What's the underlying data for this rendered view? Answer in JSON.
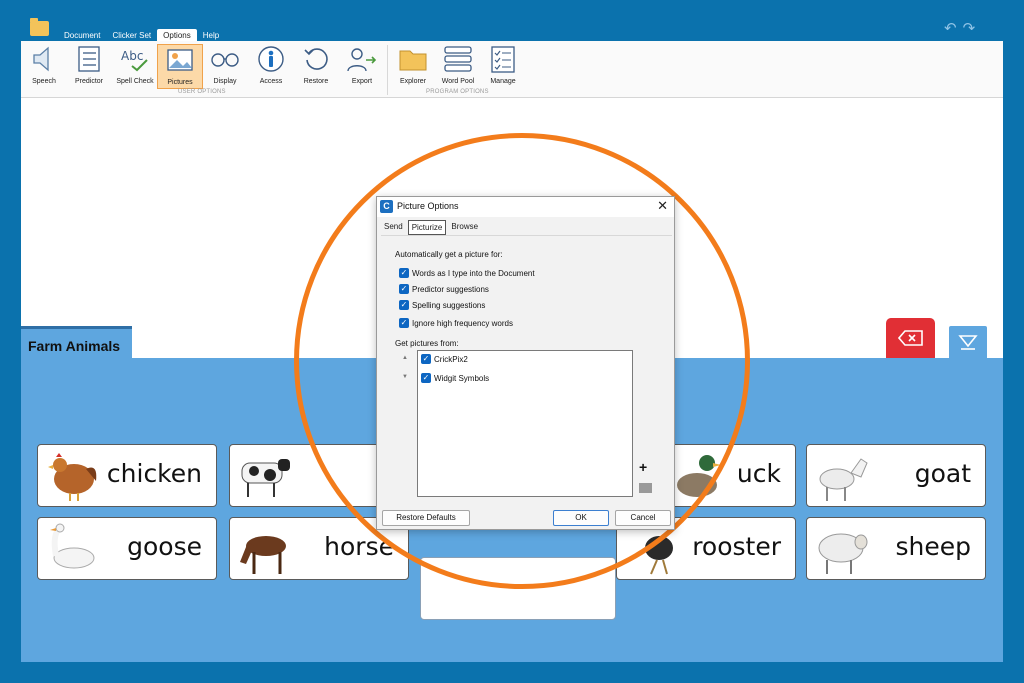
{
  "menu": {
    "tabs": [
      "Document",
      "Clicker Set",
      "Options",
      "Help"
    ],
    "active": "Options"
  },
  "ribbon": {
    "user_options": [
      {
        "label": "Speech",
        "icon": "speaker-icon"
      },
      {
        "label": "Predictor",
        "icon": "predictor-list-icon"
      },
      {
        "label": "Spell Check",
        "icon": "spell-check-icon"
      },
      {
        "label": "Pictures",
        "icon": "picture-icon"
      },
      {
        "label": "Display",
        "icon": "glasses-icon"
      },
      {
        "label": "Access",
        "icon": "accessibility-icon"
      },
      {
        "label": "Restore",
        "icon": "restore-icon"
      },
      {
        "label": "Export",
        "icon": "export-user-icon"
      }
    ],
    "program_options": [
      {
        "label": "Explorer",
        "icon": "folder-icon"
      },
      {
        "label": "Word Pool",
        "icon": "word-pool-icon"
      },
      {
        "label": "Manage",
        "icon": "manage-checklist-icon"
      }
    ],
    "group_user": "USER OPTIONS",
    "group_program": "PROGRAM OPTIONS",
    "active": "Pictures"
  },
  "set": {
    "tab_label": "Farm Animals",
    "cells": [
      {
        "word": "chicken",
        "icon": "chicken-picture"
      },
      {
        "word": "goat",
        "icon": "goat-picture"
      },
      {
        "word": "goose",
        "icon": "goose-picture"
      },
      {
        "word": "horse",
        "icon": "horse-picture"
      },
      {
        "word": "rooster",
        "icon": "rooster-picture"
      },
      {
        "word": "sheep",
        "icon": "sheep-picture"
      },
      {
        "word": "uck",
        "icon": "duck-picture"
      }
    ]
  },
  "dialog": {
    "title": "Picture Options",
    "tabs": [
      "Send",
      "Picturize",
      "Browse"
    ],
    "active_tab": "Picturize",
    "auto_heading": "Automatically get a picture for:",
    "auto_options": [
      {
        "label": "Words as I type into the Document",
        "checked": true
      },
      {
        "label": "Predictor suggestions",
        "checked": true
      },
      {
        "label": "Spelling suggestions",
        "checked": true
      },
      {
        "label": "Ignore high frequency words",
        "checked": true
      }
    ],
    "sources_heading": "Get pictures from:",
    "sources": [
      {
        "label": "CrickPix2",
        "checked": true
      },
      {
        "label": "Widgit Symbols",
        "checked": true
      }
    ],
    "restore_defaults": "Restore Defaults",
    "ok": "OK",
    "cancel": "Cancel"
  },
  "colors": {
    "background": "#0b72ad",
    "panel": "#5ea6df",
    "highlight_ring": "#f37c1b",
    "delete_button": "#e12f35",
    "checkbox": "#0d66c2"
  }
}
